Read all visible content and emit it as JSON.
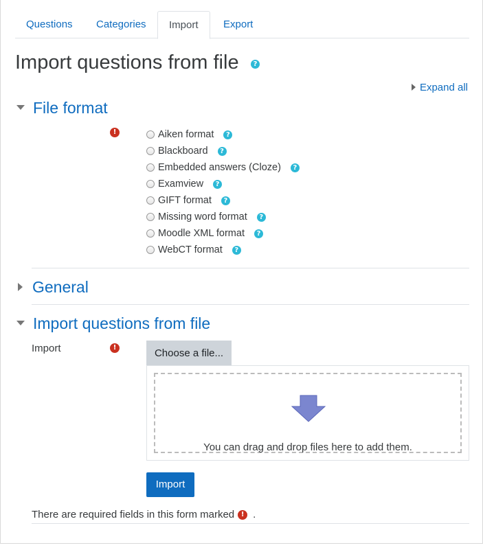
{
  "tabs": [
    {
      "label": "Questions"
    },
    {
      "label": "Categories"
    },
    {
      "label": "Import",
      "active": true
    },
    {
      "label": "Export"
    }
  ],
  "page_title": "Import questions from file",
  "expand_all": "Expand all",
  "sections": {
    "file_format": {
      "title": "File format",
      "options": [
        {
          "label": "Aiken format"
        },
        {
          "label": "Blackboard"
        },
        {
          "label": "Embedded answers (Cloze)"
        },
        {
          "label": "Examview"
        },
        {
          "label": "GIFT format"
        },
        {
          "label": "Missing word format"
        },
        {
          "label": "Moodle XML format"
        },
        {
          "label": "WebCT format"
        }
      ]
    },
    "general": {
      "title": "General"
    },
    "import_file": {
      "title": "Import questions from file",
      "field_label": "Import",
      "choose_button": "Choose a file...",
      "drop_text": "You can drag and drop files here to add them."
    }
  },
  "import_button": "Import",
  "required_note": {
    "before": "There are required fields in this form marked",
    "after": "."
  },
  "colors": {
    "link": "#0f6cbf",
    "help": "#2cb9d7",
    "required": "#ca3120",
    "arrow": "#7b86cf"
  }
}
